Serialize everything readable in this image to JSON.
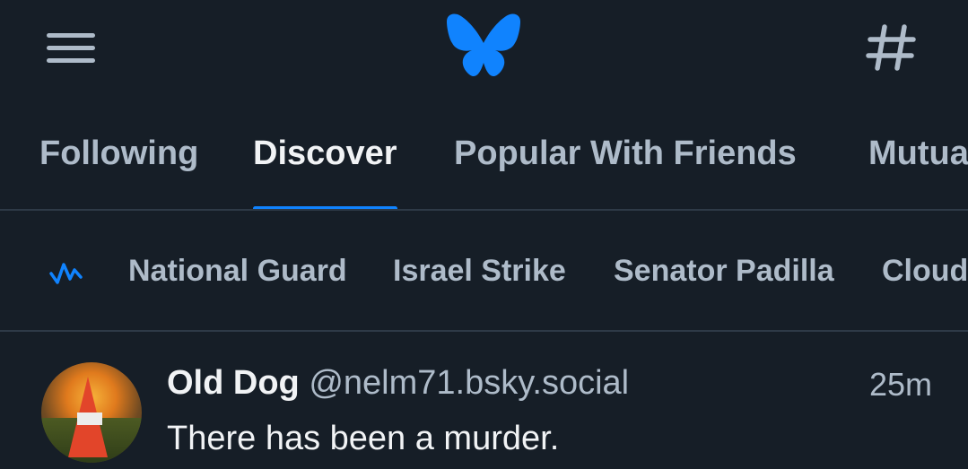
{
  "header": {
    "menu_icon": "hamburger-menu-icon",
    "logo_icon": "butterfly-logo-icon",
    "logo_color": "#1083fe",
    "feeds_icon": "hashtag-icon"
  },
  "tabs": [
    {
      "label": "Following",
      "active": false
    },
    {
      "label": "Discover",
      "active": true
    },
    {
      "label": "Popular With Friends",
      "active": false
    },
    {
      "label": "Mutua",
      "active": false
    }
  ],
  "trending": {
    "icon": "trending-pulse-icon",
    "items": [
      "National Guard",
      "Israel Strike",
      "Senator Padilla",
      "Cloud"
    ]
  },
  "post": {
    "author": "Old Dog",
    "handle": "@nelm71.bsky.social",
    "time": "25m",
    "text": "There has been a murder."
  },
  "colors": {
    "background": "#161e27",
    "accent": "#1083fe",
    "muted": "#aebbc9",
    "divider": "#2e3a47"
  }
}
